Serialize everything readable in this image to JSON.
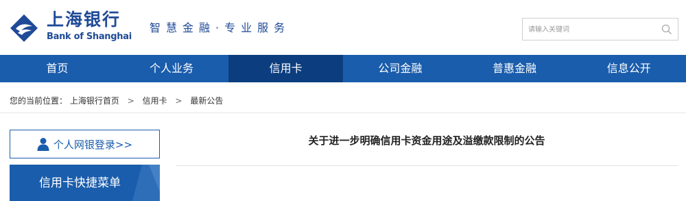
{
  "brand": {
    "name_cn": "上海银行",
    "name_en": "Bank of Shanghai",
    "slogan": "智慧金融·专业服务",
    "color": "#1f4a97"
  },
  "search": {
    "placeholder": "请输入关键词",
    "icon": "search-icon"
  },
  "nav": {
    "items": [
      {
        "label": "首页"
      },
      {
        "label": "个人业务"
      },
      {
        "label": "信用卡"
      },
      {
        "label": "公司金融"
      },
      {
        "label": "普惠金融"
      },
      {
        "label": "信息公开"
      }
    ],
    "active_index": 2,
    "bg_color": "#1a5dac",
    "active_color": "#0c3e7f"
  },
  "breadcrumb": {
    "prefix": "您的当前位置：",
    "items": [
      "上海银行首页",
      "信用卡",
      "最新公告"
    ],
    "separator": ">"
  },
  "sidebar": {
    "login_label": "个人网银登录>>",
    "login_icon": "user-icon",
    "quick_menu_title": "信用卡快捷菜单"
  },
  "article": {
    "title": "关于进一步明确信用卡资金用途及溢缴款限制的公告"
  }
}
